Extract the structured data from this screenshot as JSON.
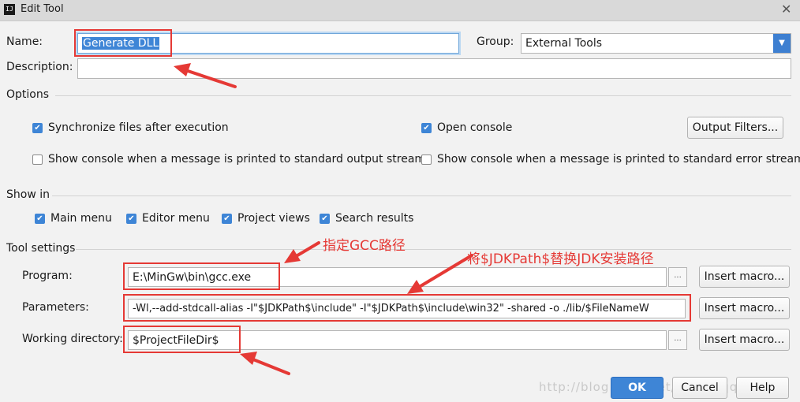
{
  "window": {
    "app_icon": "IJ",
    "title": "Edit Tool",
    "close_glyph": "✕"
  },
  "name": {
    "label": "Name:",
    "value": "Generate DLL"
  },
  "group": {
    "label": "Group:",
    "value": "External Tools"
  },
  "description": {
    "label": "Description:",
    "value": ""
  },
  "options": {
    "header": "Options",
    "sync_files": {
      "label": "Synchronize files after execution",
      "checked": true
    },
    "open_console": {
      "label": "Open console",
      "checked": true
    },
    "output_filters_button": "Output Filters...",
    "show_console_stdout": {
      "label": "Show console when a message is printed to standard output stream",
      "checked": false
    },
    "show_console_stderr": {
      "label": "Show console when a message is printed to standard error stream",
      "checked": false
    }
  },
  "show_in": {
    "header": "Show in",
    "items": [
      {
        "label": "Main menu",
        "checked": true
      },
      {
        "label": "Editor menu",
        "checked": true
      },
      {
        "label": "Project views",
        "checked": true
      },
      {
        "label": "Search results",
        "checked": true
      }
    ]
  },
  "tool_settings": {
    "header": "Tool settings",
    "program": {
      "label": "Program:",
      "value": "E:\\MinGw\\bin\\gcc.exe"
    },
    "parameters": {
      "label": "Parameters:",
      "value": "-Wl,--add-stdcall-alias -I\"$JDKPath$\\include\" -I\"$JDKPath$\\include\\win32\" -shared -o ./lib/$FileNameW"
    },
    "working_directory": {
      "label": "Working directory:",
      "value": "$ProjectFileDir$"
    },
    "browse_glyph": "...",
    "insert_macro_button": "Insert macro..."
  },
  "annotations": {
    "gcc": "指定GCC路径",
    "jdk": "将$JDKPath$替换JDK安装路径"
  },
  "footer": {
    "ok": "OK",
    "cancel": "Cancel",
    "help": "Help",
    "watermark": "http://blog.csdn.net/dqwjcsqq2010"
  },
  "colors": {
    "accent": "#3e85d6",
    "annotation_red": "#e53935"
  },
  "icons": {
    "checkbox_checked": "check-icon",
    "combo": "chevron-down-icon",
    "close": "close-icon"
  }
}
